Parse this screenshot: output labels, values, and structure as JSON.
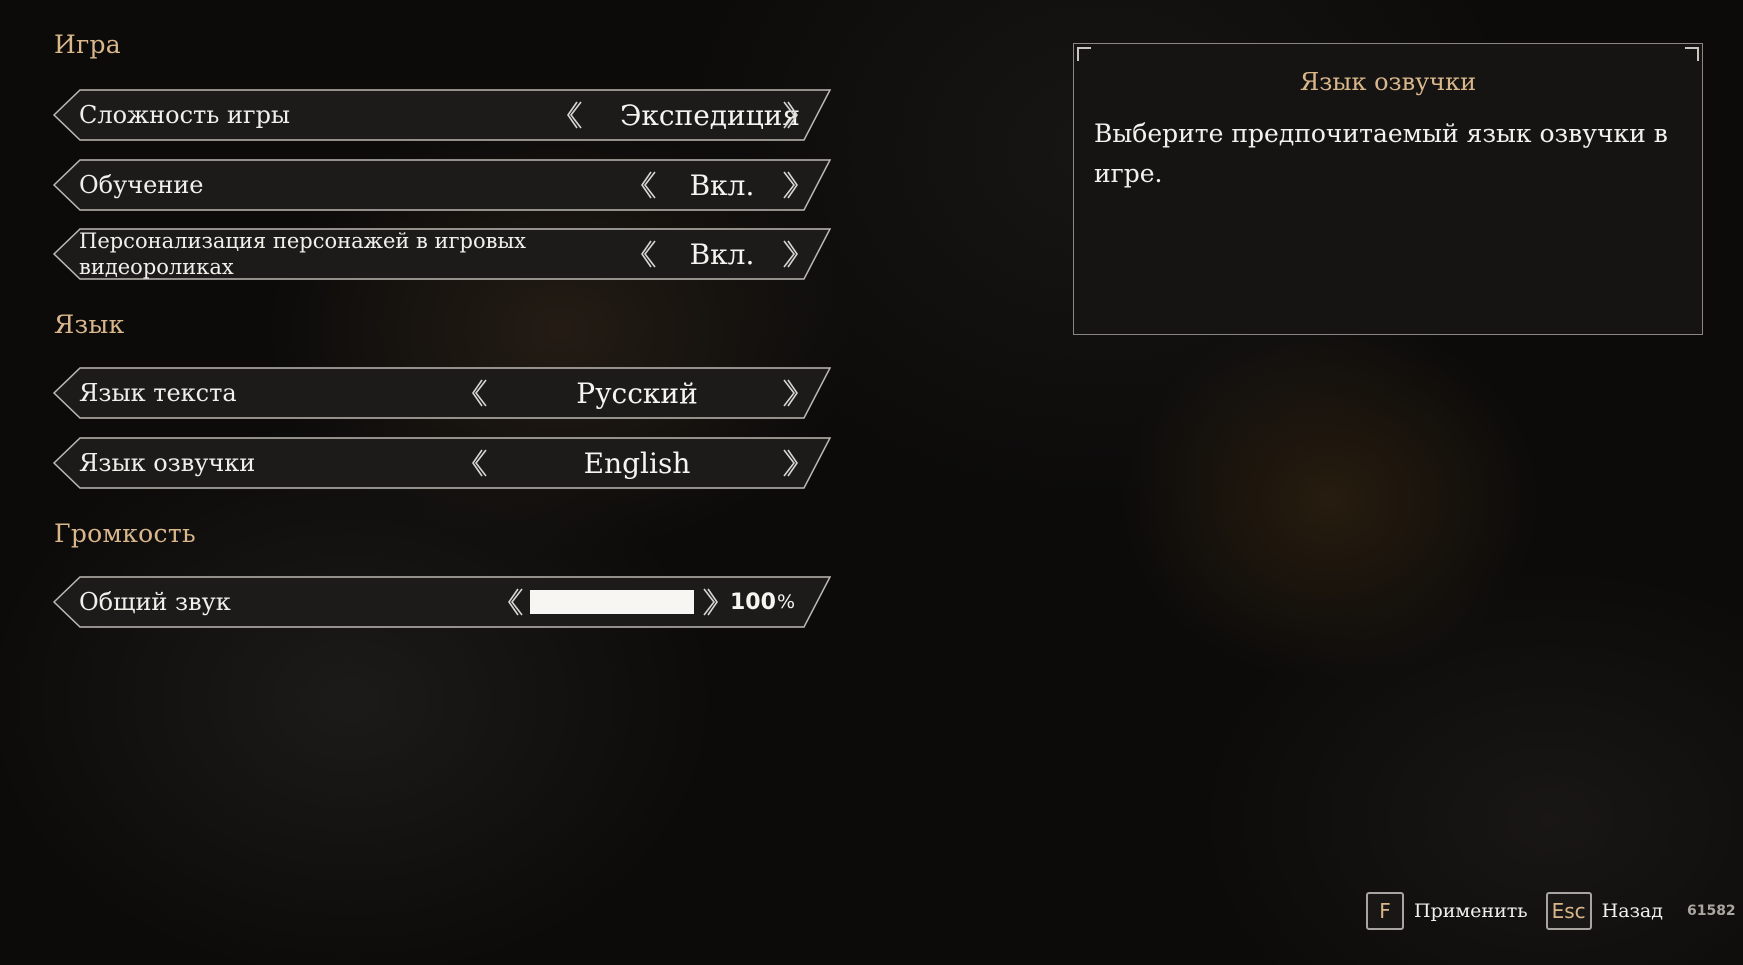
{
  "sections": {
    "game": "Игра",
    "language": "Язык",
    "volume": "Громкость"
  },
  "settings": {
    "difficulty": {
      "label": "Сложность игры",
      "value": "Экспедиция"
    },
    "tutorial": {
      "label": "Обучение",
      "value": "Вкл."
    },
    "personalization": {
      "label": "Персонализация персонажей в игровых видеороликах",
      "value": "Вкл."
    },
    "text_language": {
      "label": "Язык текста",
      "value": "Русский"
    },
    "voice_language": {
      "label": "Язык озвучки",
      "value": "English"
    },
    "master_volume": {
      "label": "Общий звук",
      "value_text": "100",
      "percent_sign": "%",
      "level": 1.0
    }
  },
  "info_panel": {
    "title": "Язык озвучки",
    "description": "Выберите предпочитаемый язык озвучки в игре."
  },
  "footer": {
    "apply_key": "F",
    "apply_label": "Применить",
    "back_key": "Esc",
    "back_label": "Назад",
    "build": "61582"
  },
  "colors": {
    "section_title": "#d9b78b",
    "text": "#f0efea",
    "row_bg": "#1c1b1a"
  },
  "icons": [
    "chevron-left-icon",
    "chevron-right-icon"
  ]
}
